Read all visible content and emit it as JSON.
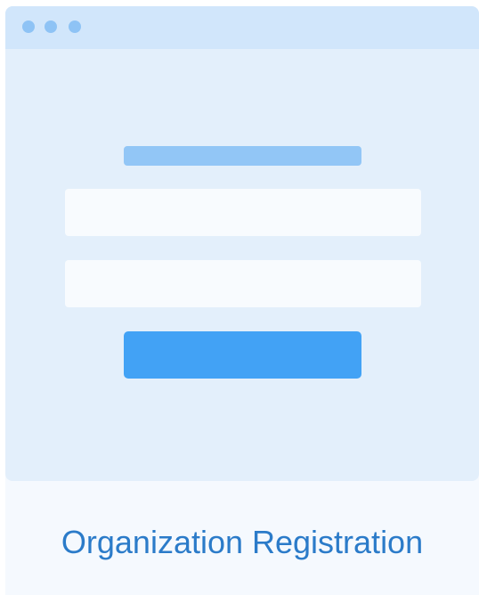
{
  "colors": {
    "window_dot": "#8ec3f5",
    "heading_bar": "#92c6f6",
    "submit_button": "#42a2f5",
    "caption_text": "#2b7bc9"
  },
  "caption": {
    "title": "Organization Registration"
  }
}
